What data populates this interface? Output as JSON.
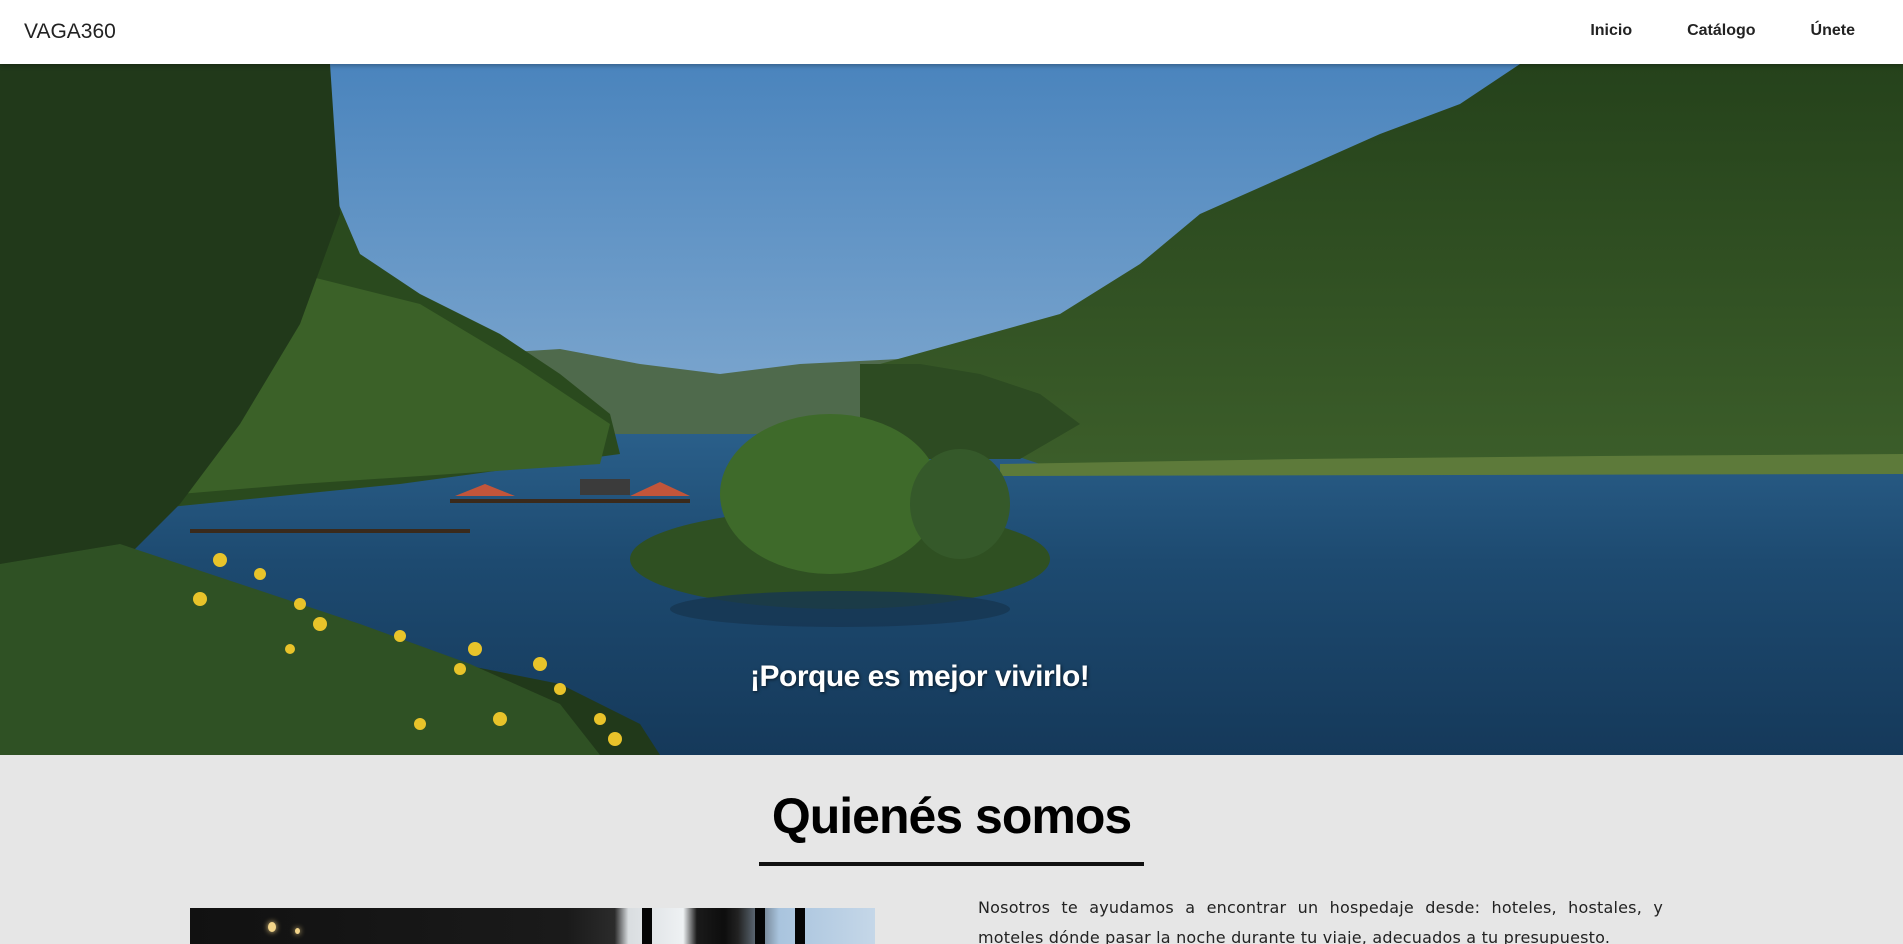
{
  "navbar": {
    "brand": "VAGA360",
    "links": [
      {
        "label": "Inicio"
      },
      {
        "label": "Catálogo"
      },
      {
        "label": "Únete"
      }
    ]
  },
  "hero": {
    "caption": "¡Porque es mejor vivirlo!",
    "image_subject": "lake-landscape"
  },
  "about": {
    "title": "Quienés somos",
    "text": "Nosotros te ayudamos a encontrar un hospedaje desde: hoteles, hostales, y moteles dónde pasar la noche durante tu viaje, adecuados a tu presupuesto."
  },
  "colors": {
    "navbar_bg": "#ffffff",
    "section_bg": "#e6e6e6",
    "sky": "#5a8fc2",
    "water": "#1d4a6e",
    "foliage": "#2f4f22"
  }
}
